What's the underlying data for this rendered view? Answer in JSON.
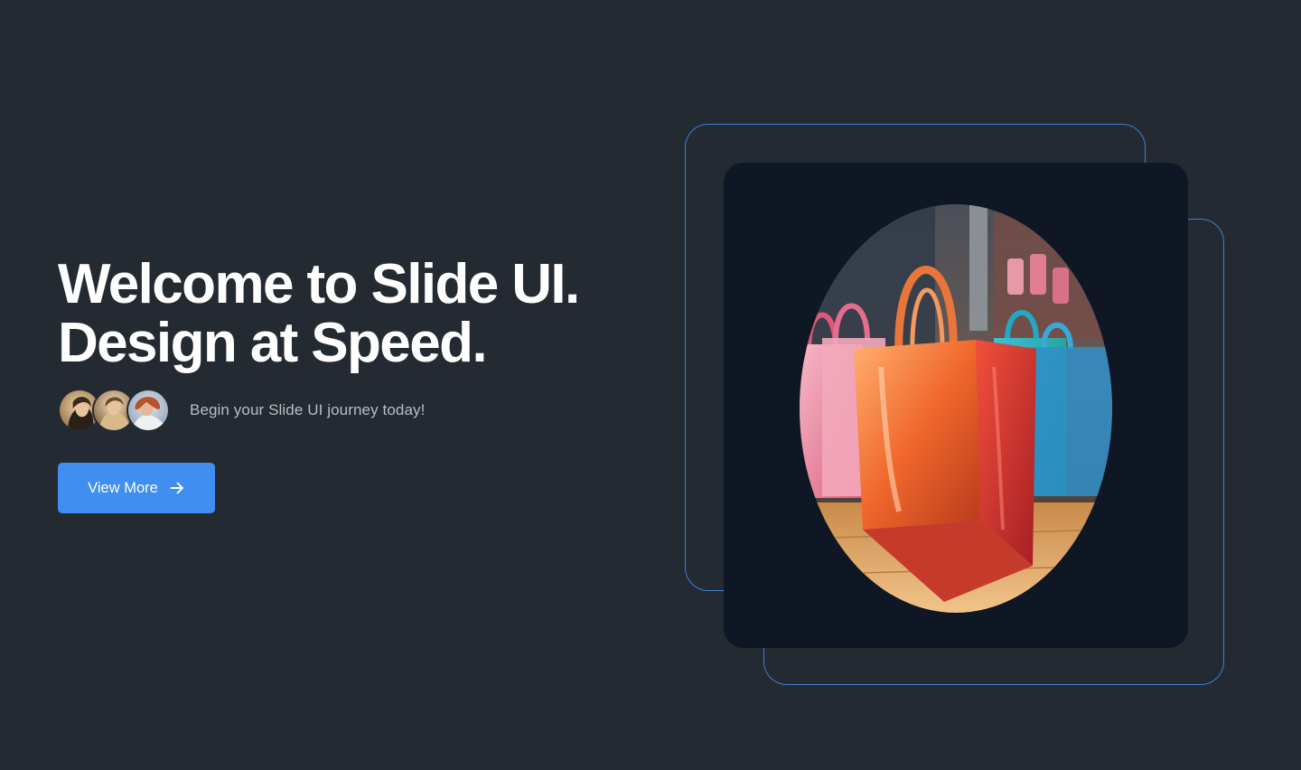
{
  "hero": {
    "title_line1": "Welcome to Slide UI.",
    "title_line2": "Design at Speed.",
    "tagline": "Begin your Slide UI journey today!",
    "cta_label": "View More"
  },
  "avatars": [
    {
      "icon": "avatar-1"
    },
    {
      "icon": "avatar-2"
    },
    {
      "icon": "avatar-3"
    }
  ],
  "colors": {
    "background": "#242a31",
    "accent": "#3f8ef0",
    "outline": "#3c7fd6",
    "card": "#0f1725"
  },
  "icons": {
    "cta": "arrow-right-icon"
  }
}
